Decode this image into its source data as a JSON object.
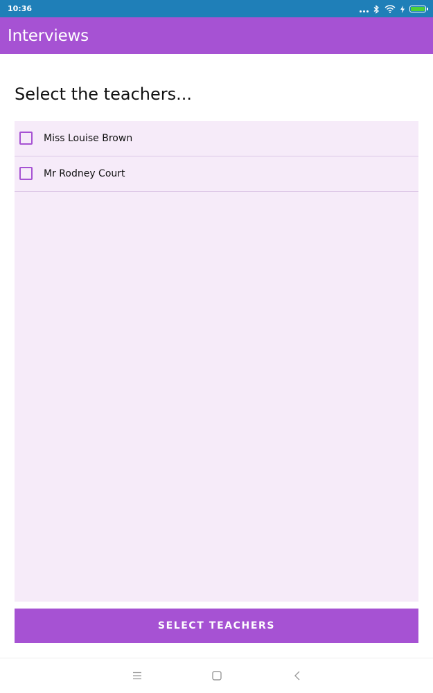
{
  "status_bar": {
    "time": "10:36"
  },
  "app_bar": {
    "title": "Interviews"
  },
  "page": {
    "heading": "Select the teachers..."
  },
  "teachers": [
    {
      "name": "Miss Louise Brown",
      "checked": false
    },
    {
      "name": "Mr Rodney Court",
      "checked": false
    }
  ],
  "actions": {
    "select_label": "SELECT TEACHERS"
  },
  "colors": {
    "status_bar": "#1f7fb8",
    "accent": "#a652d3",
    "list_background": "#f6ebf9",
    "battery": "#4cd137"
  },
  "icons": {
    "status": [
      "more-dots-icon",
      "bluetooth-icon",
      "wifi-icon",
      "charging-bolt-icon",
      "battery-icon"
    ],
    "navigation": [
      "menu-icon",
      "home-icon",
      "back-icon"
    ]
  }
}
